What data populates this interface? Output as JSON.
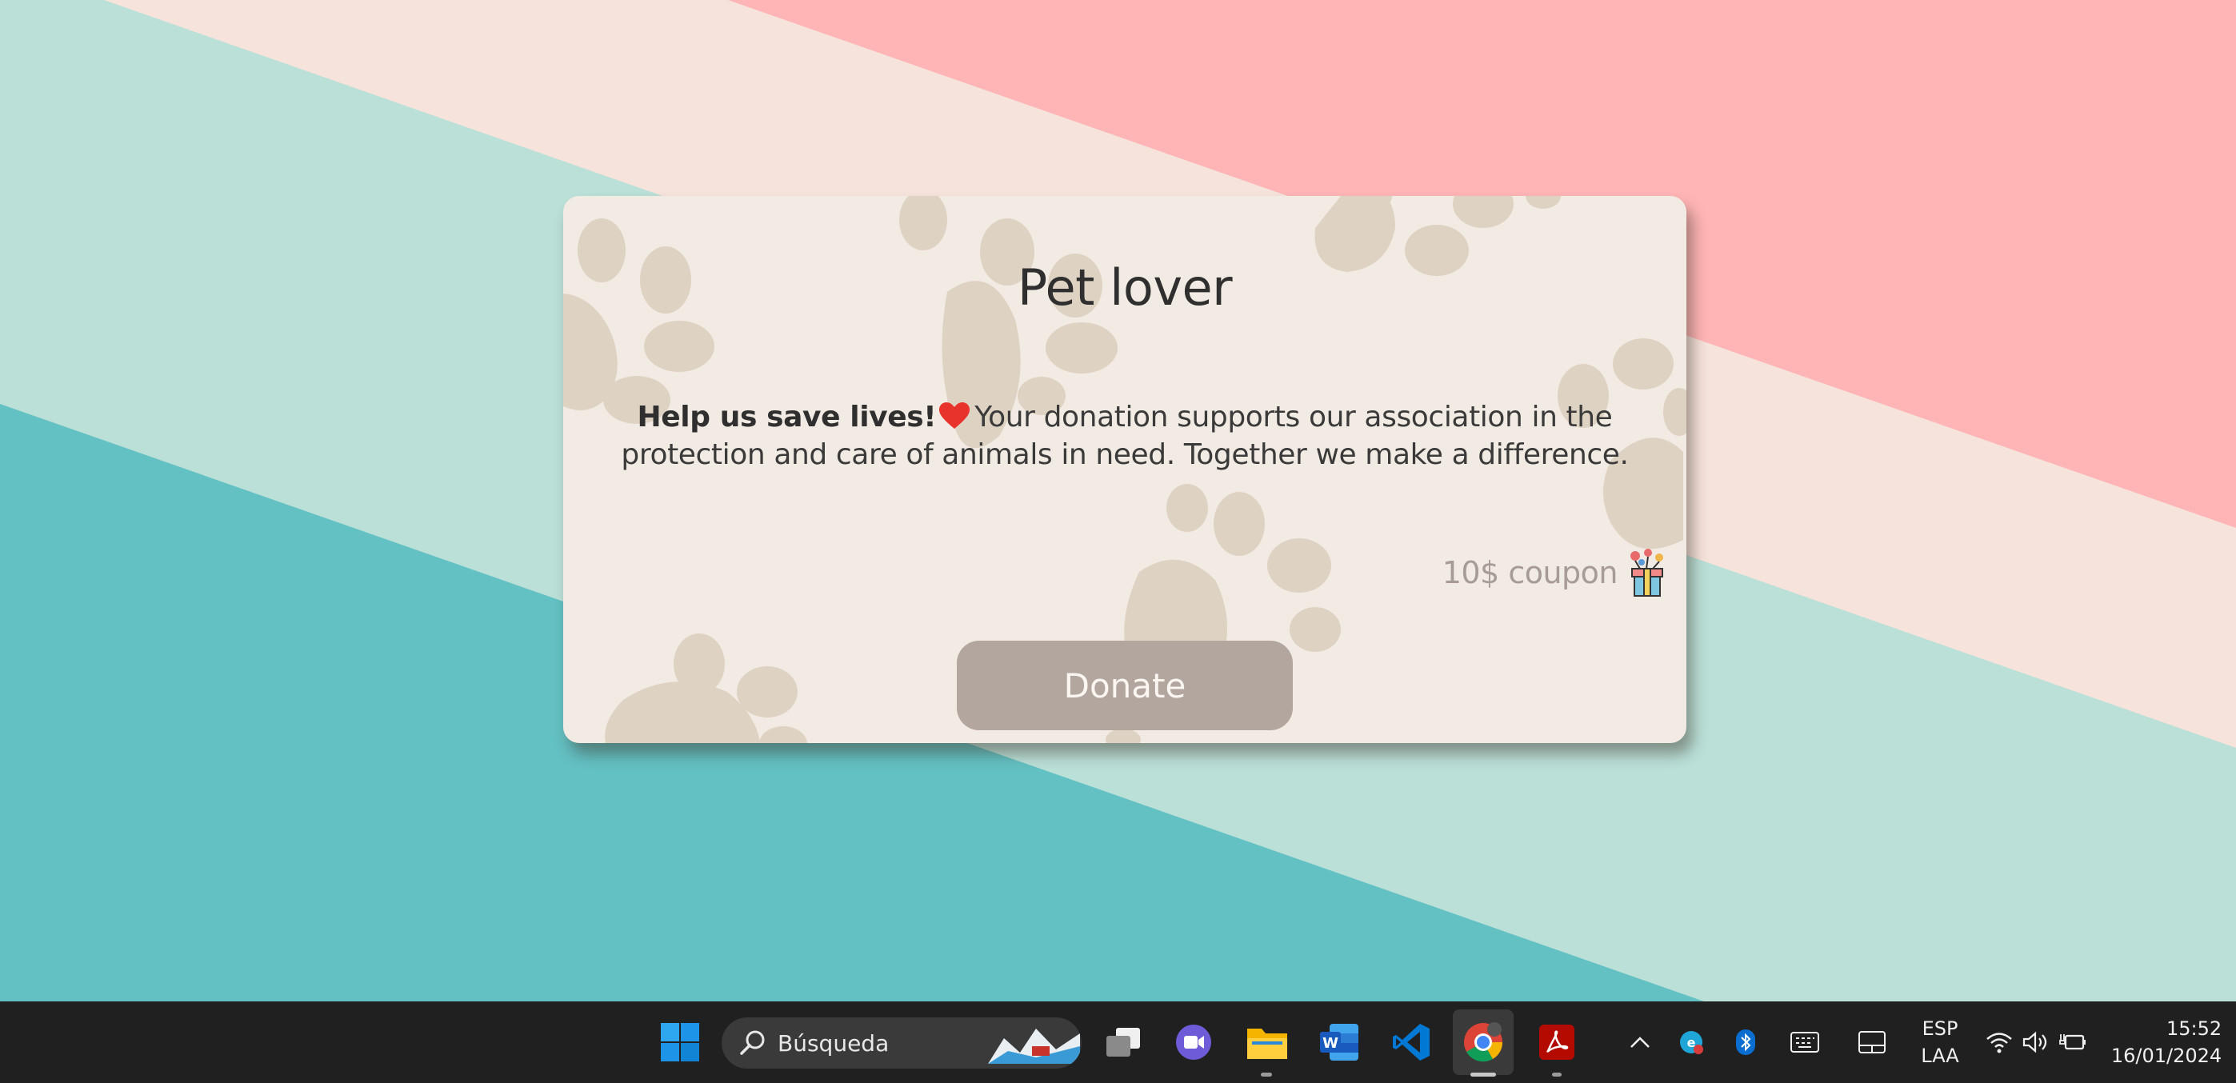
{
  "card": {
    "title": "Pet lover",
    "message_bold": "Help us save lives!",
    "message": "Your donation supports our association in the protection and care of animals in need. Together we make a difference.",
    "coupon": "10$ coupon",
    "donate_button": "Donate"
  },
  "taskbar": {
    "search_placeholder": "Búsqueda",
    "language": "ESP",
    "keyboard_layout": "LAA",
    "time": "15:52",
    "date": "16/01/2024"
  },
  "colors": {
    "stripe_teal": "#63c0c3",
    "stripe_mint": "#bae0d8",
    "stripe_cream": "#f6e3db",
    "stripe_pink": "#ffb5b5",
    "card_bg": "#f2ebe3",
    "paw": "#ded3c2",
    "button": "#b2a69f",
    "coupon_text": "#a69c95",
    "taskbar": "#202020"
  }
}
